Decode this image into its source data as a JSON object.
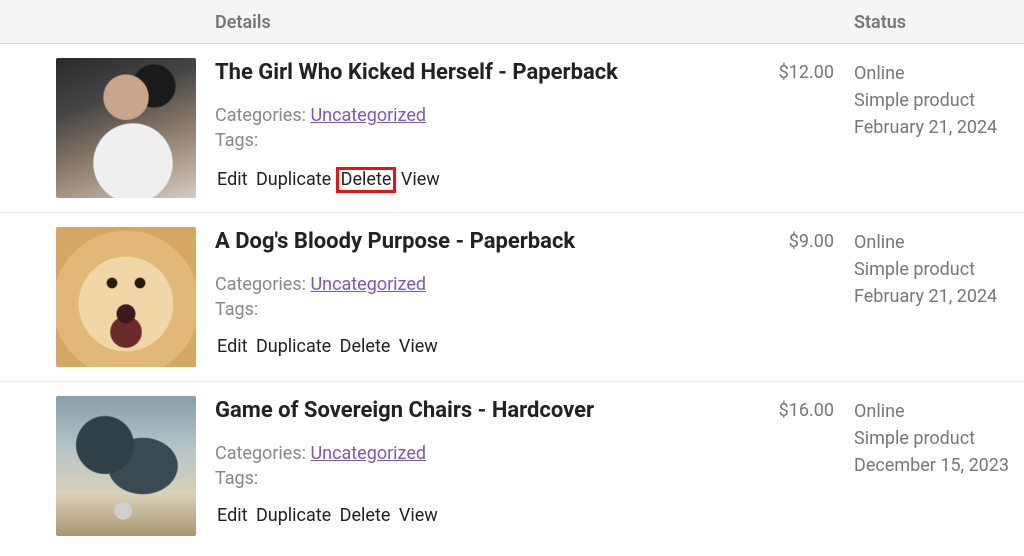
{
  "header": {
    "details_label": "Details",
    "status_label": "Status"
  },
  "labels": {
    "categories": "Categories:",
    "tags": "Tags:"
  },
  "actions": {
    "edit": "Edit",
    "duplicate": "Duplicate",
    "delete": "Delete",
    "view": "View"
  },
  "products": [
    {
      "title": "The Girl Who Kicked Herself - Paperback",
      "category": "Uncategorized",
      "price": "$12.00",
      "status_line1": "Online",
      "status_line2": "Simple product",
      "status_line3": "February 21, 2024",
      "highlight_delete": true
    },
    {
      "title": "A Dog's Bloody Purpose - Paperback",
      "category": "Uncategorized",
      "price": "$9.00",
      "status_line1": "Online",
      "status_line2": "Simple product",
      "status_line3": "February 21, 2024",
      "highlight_delete": false
    },
    {
      "title": "Game of Sovereign Chairs - Hardcover",
      "category": "Uncategorized",
      "price": "$16.00",
      "status_line1": "Online",
      "status_line2": "Simple product",
      "status_line3": "December 15, 2023",
      "highlight_delete": false
    }
  ]
}
